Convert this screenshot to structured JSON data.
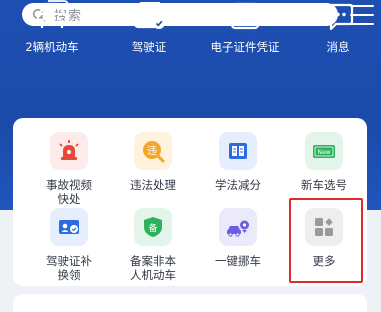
{
  "search": {
    "placeholder": "搜索"
  },
  "top_services": [
    {
      "label": "2辆机动车",
      "icon": "car-icon"
    },
    {
      "label": "驾驶证",
      "icon": "license-card-icon"
    },
    {
      "label": "电子证件凭证",
      "icon": "wallet-icon"
    },
    {
      "label": "消息",
      "icon": "message-bubble-icon"
    }
  ],
  "grid_services": [
    {
      "label_lines": [
        "事故视频",
        "快处"
      ],
      "icon": "siren-icon",
      "tile_color": "#fdeaea"
    },
    {
      "label_lines": [
        "违法处理"
      ],
      "icon": "violation-badge-icon",
      "tile_color": "#fff3dd",
      "badge_text": "违"
    },
    {
      "label_lines": [
        "学法减分"
      ],
      "icon": "book-icon",
      "tile_color": "#e5eefc"
    },
    {
      "label_lines": [
        "新车选号"
      ],
      "icon": "new-plate-icon",
      "tile_color": "#e3f5ea",
      "badge_text": "New"
    },
    {
      "label_lines": [
        "驾驶证补",
        "换领"
      ],
      "icon": "id-card-icon",
      "tile_color": "#e5eefc"
    },
    {
      "label_lines": [
        "备案非本",
        "人机动车"
      ],
      "icon": "shield-record-icon",
      "tile_color": "#e3f5ea",
      "badge_text": "备"
    },
    {
      "label_lines": [
        "一键挪车"
      ],
      "icon": "move-car-icon",
      "tile_color": "#ebeafb"
    },
    {
      "label_lines": [
        "更多"
      ],
      "icon": "more-grid-icon",
      "tile_color": "#eeeeee"
    }
  ],
  "colors": {
    "header_blue": "#1b4aa9",
    "highlight_red": "#e12b2b"
  }
}
